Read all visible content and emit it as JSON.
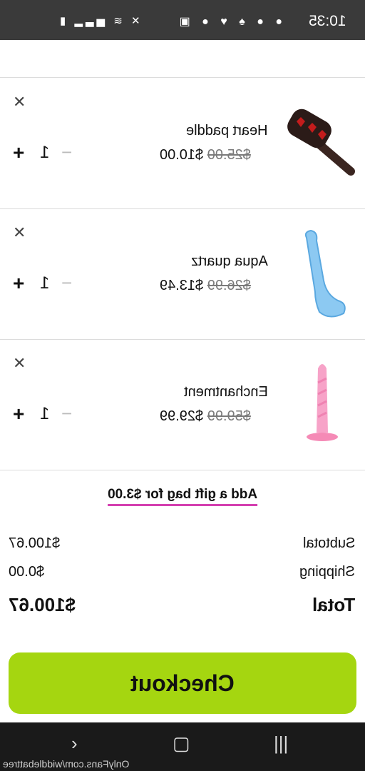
{
  "status_bar": {
    "time": "10:35"
  },
  "cart": {
    "items": [
      {
        "name": "Heart paddle",
        "old_price": "$25.00",
        "price": "$10.00",
        "quantity": "1"
      },
      {
        "name": "Aqua quartz",
        "old_price": "$26.99",
        "price": "$13.49",
        "quantity": "1"
      },
      {
        "name": "Enchantment",
        "old_price": "$59.99",
        "price": "$29.99",
        "quantity": "1"
      }
    ],
    "gift_bag_label": "Add a gift bag for $3.00"
  },
  "summary": {
    "subtotal_label": "Subtotal",
    "subtotal": "$100.67",
    "shipping_label": "Shipping",
    "shipping": "$0.00",
    "total_label": "Total",
    "total": "$100.67"
  },
  "checkout_label": "Checkout",
  "nav_bar": {
    "watermark": "OnlyFans.com/widdlebattree"
  },
  "colors": {
    "accent": "#a5d610",
    "link_underline": "#d43fb0"
  }
}
